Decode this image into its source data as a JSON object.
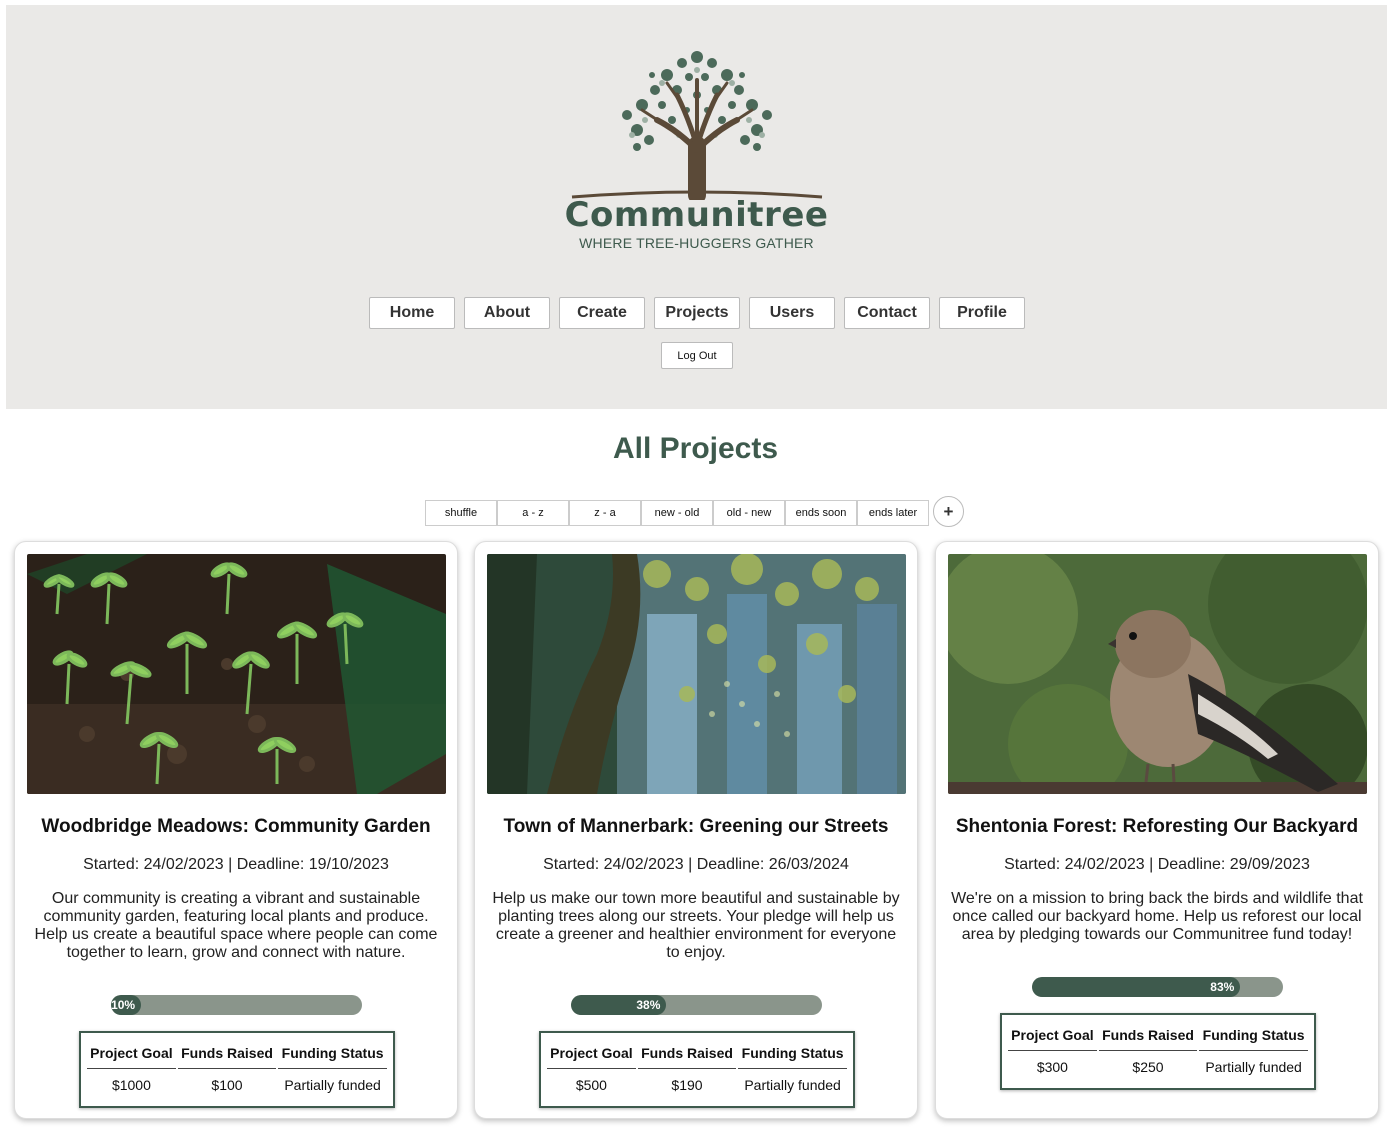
{
  "brand": {
    "name": "Communitree",
    "tagline": "WHERE TREE-HUGGERS GATHER"
  },
  "nav": {
    "items": [
      "Home",
      "About",
      "Create",
      "Projects",
      "Users",
      "Contact",
      "Profile"
    ],
    "logout": "Log Out"
  },
  "page": {
    "title": "All Projects"
  },
  "sort": {
    "options": [
      "shuffle",
      "a - z",
      "z - a",
      "new - old",
      "old - new",
      "ends soon",
      "ends later"
    ],
    "add": "+"
  },
  "table_headers": [
    "Project Goal",
    "Funds Raised",
    "Funding Status"
  ],
  "colors": {
    "brand_green": "#3e5a4d",
    "progress_track": "#8a958b",
    "header_bg": "#eae9e7"
  },
  "projects": [
    {
      "title": "Woodbridge Meadows: Community Garden",
      "dates": "Started: 24/02/2023 | Deadline: 19/10/2023",
      "description": "Our community is creating a vibrant and sustainable community garden, featuring local plants and produce. Help us create a beautiful space where people can come together to learn, grow and connect with nature.",
      "progress": 0.1,
      "progress_label": "10%",
      "goal": "$1000",
      "raised": "$100",
      "status": "Partially funded",
      "image": "seedlings-photo"
    },
    {
      "title": "Town of Mannerbark: Greening our Streets",
      "dates": "Started: 24/02/2023 | Deadline: 26/03/2024",
      "description": "Help us make our town more beautiful and sustainable by planting trees along our streets. Your pledge will help us create a greener and healthier environment for everyone to enjoy.",
      "progress": 0.38,
      "progress_label": "38%",
      "goal": "$500",
      "raised": "$190",
      "status": "Partially funded",
      "image": "street-trees-photo"
    },
    {
      "title": "Shentonia Forest: Reforesting Our Backyard",
      "dates": "Started: 24/02/2023 | Deadline: 29/09/2023",
      "description": "We're on a mission to bring back the birds and wildlife that once called our backyard home. Help us reforest our local area by pledging towards our Communitree fund today!",
      "progress": 0.83,
      "progress_label": "83%",
      "goal": "$300",
      "raised": "$250",
      "status": "Partially funded",
      "image": "bird-photo"
    }
  ]
}
